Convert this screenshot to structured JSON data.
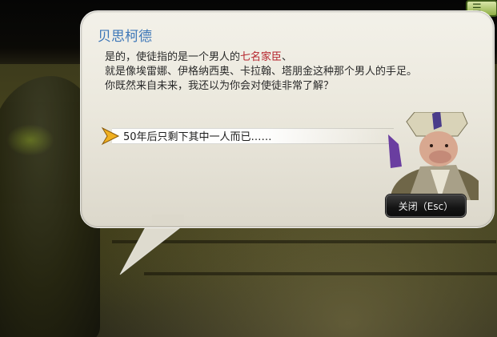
{
  "dialog": {
    "speaker_name": "贝思柯德",
    "line1_prefix": "是的，使徒指的是一个男人的",
    "line1_highlight": "七名家臣",
    "line1_suffix": "、",
    "line2": "就是像埃雷娜、伊格纳西奥、卡拉翰、塔朋金这种那个男人的手足。",
    "line3": "你既然来自未来，我还以为你会对使徒非常了解？",
    "choice_text": "50年后只剩下其中一人而已……",
    "close_label": "关闭（Esc）"
  },
  "colors": {
    "speaker_name": "#3f78b8",
    "highlight": "#b5232b",
    "dialog_bg": "#ebe8dd",
    "button_bg": "#141414"
  },
  "icons": {
    "choice_arrow": "chevron-right-icon",
    "corner": "menu-toggle-icon",
    "portrait": "npc-portrait"
  }
}
